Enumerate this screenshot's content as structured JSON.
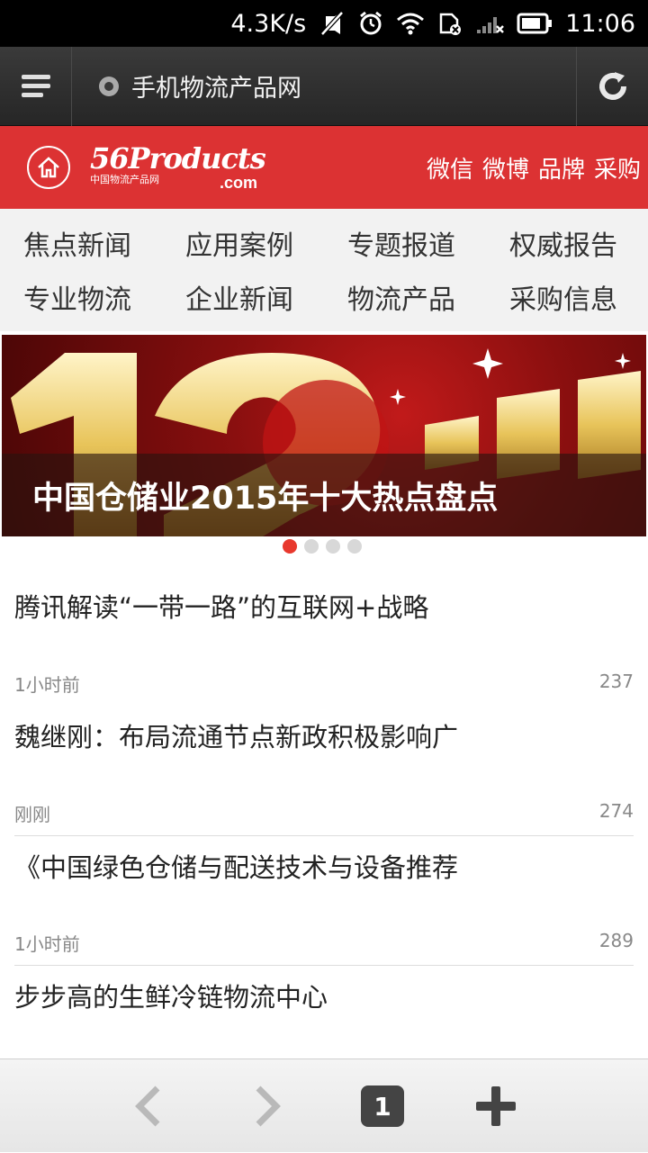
{
  "status_bar": {
    "speed": "4.3K/s",
    "time": "11:06",
    "icons": [
      "mute-icon",
      "alarm-icon",
      "wifi-icon",
      "sim-icon",
      "signal-icon",
      "battery-icon"
    ]
  },
  "browser": {
    "page_title": "手机物流产品网",
    "icons": [
      "menu-icon",
      "site-icon",
      "reload-icon"
    ]
  },
  "header": {
    "logo_main": "56Products",
    "logo_sub": "中国物流产品网",
    "logo_domain": ".com",
    "links": [
      "微信",
      "微博",
      "品牌",
      "采购"
    ],
    "color": "#dc3233"
  },
  "categories": [
    "焦点新闻",
    "应用案例",
    "专题报道",
    "权威报告",
    "专业物流",
    "企业新闻",
    "物流产品",
    "采购信息"
  ],
  "banner": {
    "caption": "中国仓储业2015年十大热点盘点",
    "slide_count": 4,
    "active_slide": 1
  },
  "news": [
    {
      "title": "腾讯解读“一带一路”的互联网+战略",
      "time": "1小时前",
      "count": "237"
    },
    {
      "title": "魏继刚：布局流通节点新政积极影响广",
      "time": "刚刚",
      "count": "274"
    },
    {
      "title": "《中国绿色仓储与配送技术与设备推荐",
      "time": "1小时前",
      "count": "289"
    },
    {
      "title": "步步高的生鲜冷链物流中心"
    }
  ],
  "bottom_bar": {
    "tab_count": "1",
    "icons": [
      "back-icon",
      "forward-icon",
      "tabs-icon",
      "add-tab-icon"
    ]
  }
}
